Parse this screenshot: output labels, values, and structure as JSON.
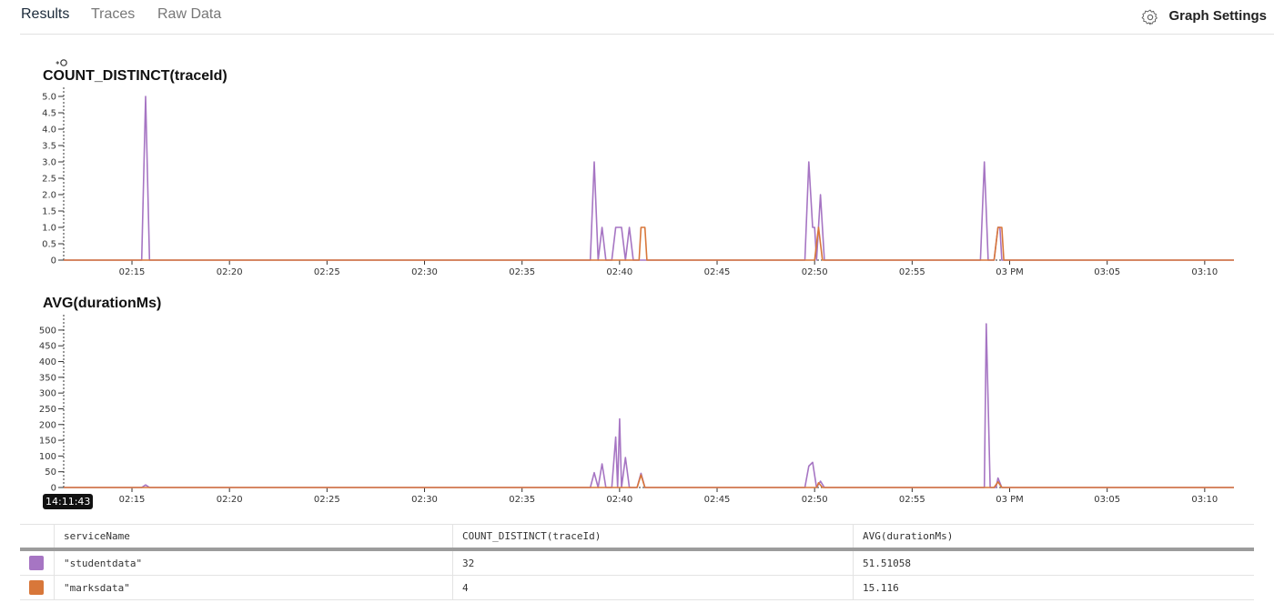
{
  "tabs": [
    {
      "label": "Results",
      "active": true
    },
    {
      "label": "Traces",
      "active": false
    },
    {
      "label": "Raw Data",
      "active": false
    }
  ],
  "graph_settings": {
    "label": "Graph Settings",
    "icon": "gear-icon"
  },
  "colors": {
    "studentdata": "#a675c3",
    "marksdata": "#d8773a",
    "grid": "#000000"
  },
  "cursor": {
    "time_label": "14:11:43",
    "icon": "crosshair-zoom-icon"
  },
  "chart_data": [
    {
      "type": "line",
      "title": "COUNT_DISTINCT(traceId)",
      "x_ticks": [
        "02:15",
        "02:20",
        "02:25",
        "02:30",
        "02:35",
        "02:40",
        "02:45",
        "02:50",
        "02:55",
        "03 PM",
        "03:05",
        "03:10"
      ],
      "y_ticks": [
        "0",
        "0.5",
        "1.0",
        "1.5",
        "2.0",
        "2.5",
        "3.0",
        "3.5",
        "4.0",
        "4.5",
        "5.0"
      ],
      "ylim": [
        0,
        5
      ],
      "xlim_minutes": [
        -3.5,
        56.5
      ],
      "series": [
        {
          "name": "\"studentdata\"",
          "color": "#a675c3",
          "points": [
            [
              -3.5,
              0
            ],
            [
              0.5,
              0
            ],
            [
              0.7,
              5
            ],
            [
              0.9,
              0
            ],
            [
              23.5,
              0
            ],
            [
              23.7,
              3
            ],
            [
              23.9,
              0
            ],
            [
              24.1,
              1
            ],
            [
              24.3,
              0
            ],
            [
              24.6,
              0
            ],
            [
              24.8,
              1
            ],
            [
              25.1,
              1
            ],
            [
              25.3,
              0
            ],
            [
              25.5,
              1
            ],
            [
              25.7,
              0
            ],
            [
              34.5,
              0
            ],
            [
              34.7,
              3
            ],
            [
              34.9,
              1
            ],
            [
              35.0,
              1
            ],
            [
              35.1,
              0
            ],
            [
              35.3,
              2
            ],
            [
              35.5,
              0
            ],
            [
              43.5,
              0
            ],
            [
              43.7,
              3
            ],
            [
              43.9,
              0
            ],
            [
              44.2,
              0
            ],
            [
              44.4,
              1
            ],
            [
              44.5,
              1
            ],
            [
              44.6,
              0
            ],
            [
              56.5,
              0
            ]
          ]
        },
        {
          "name": "\"marksdata\"",
          "color": "#d8773a",
          "points": [
            [
              -3.5,
              0
            ],
            [
              26.0,
              0
            ],
            [
              26.1,
              1
            ],
            [
              26.3,
              1
            ],
            [
              26.4,
              0
            ],
            [
              35.0,
              0
            ],
            [
              35.2,
              1
            ],
            [
              35.4,
              0
            ],
            [
              44.2,
              0
            ],
            [
              44.4,
              1
            ],
            [
              44.6,
              1
            ],
            [
              44.7,
              0
            ],
            [
              56.5,
              0
            ]
          ]
        }
      ]
    },
    {
      "type": "line",
      "title": "AVG(durationMs)",
      "x_ticks": [
        "02:15",
        "02:20",
        "02:25",
        "02:30",
        "02:35",
        "02:40",
        "02:45",
        "02:50",
        "02:55",
        "03 PM",
        "03:05",
        "03:10"
      ],
      "y_ticks": [
        "0",
        "50",
        "100",
        "150",
        "200",
        "250",
        "300",
        "350",
        "400",
        "450",
        "500"
      ],
      "ylim": [
        0,
        520
      ],
      "xlim_minutes": [
        -3.5,
        56.5
      ],
      "series": [
        {
          "name": "\"studentdata\"",
          "color": "#a675c3",
          "points": [
            [
              -3.5,
              0
            ],
            [
              0.5,
              0
            ],
            [
              0.7,
              8
            ],
            [
              0.9,
              0
            ],
            [
              23.5,
              0
            ],
            [
              23.7,
              47
            ],
            [
              23.9,
              0
            ],
            [
              24.1,
              75
            ],
            [
              24.3,
              0
            ],
            [
              24.6,
              0
            ],
            [
              24.8,
              160
            ],
            [
              24.9,
              0
            ],
            [
              25.0,
              218
            ],
            [
              25.1,
              0
            ],
            [
              25.3,
              95
            ],
            [
              25.5,
              0
            ],
            [
              25.9,
              0
            ],
            [
              26.1,
              45
            ],
            [
              26.3,
              0
            ],
            [
              34.5,
              0
            ],
            [
              34.7,
              68
            ],
            [
              34.9,
              80
            ],
            [
              35.1,
              0
            ],
            [
              35.3,
              20
            ],
            [
              35.5,
              0
            ],
            [
              43.7,
              0
            ],
            [
              43.8,
              520
            ],
            [
              44.0,
              0
            ],
            [
              44.3,
              0
            ],
            [
              44.4,
              30
            ],
            [
              44.6,
              0
            ],
            [
              56.5,
              0
            ]
          ]
        },
        {
          "name": "\"marksdata\"",
          "color": "#d8773a",
          "points": [
            [
              -3.5,
              0
            ],
            [
              25.9,
              0
            ],
            [
              26.1,
              40
            ],
            [
              26.3,
              0
            ],
            [
              35.1,
              0
            ],
            [
              35.2,
              15
            ],
            [
              35.4,
              0
            ],
            [
              44.2,
              0
            ],
            [
              44.4,
              18
            ],
            [
              44.6,
              0
            ],
            [
              56.5,
              0
            ]
          ]
        }
      ]
    }
  ],
  "table": {
    "headers": [
      "serviceName",
      "COUNT_DISTINCT(traceId)",
      "AVG(durationMs)"
    ],
    "rows": [
      {
        "swatch_color": "#a675c3",
        "cells": [
          "\"studentdata\"",
          "32",
          "51.51058"
        ]
      },
      {
        "swatch_color": "#d8773a",
        "cells": [
          "\"marksdata\"",
          "4",
          "15.116"
        ]
      }
    ]
  }
}
